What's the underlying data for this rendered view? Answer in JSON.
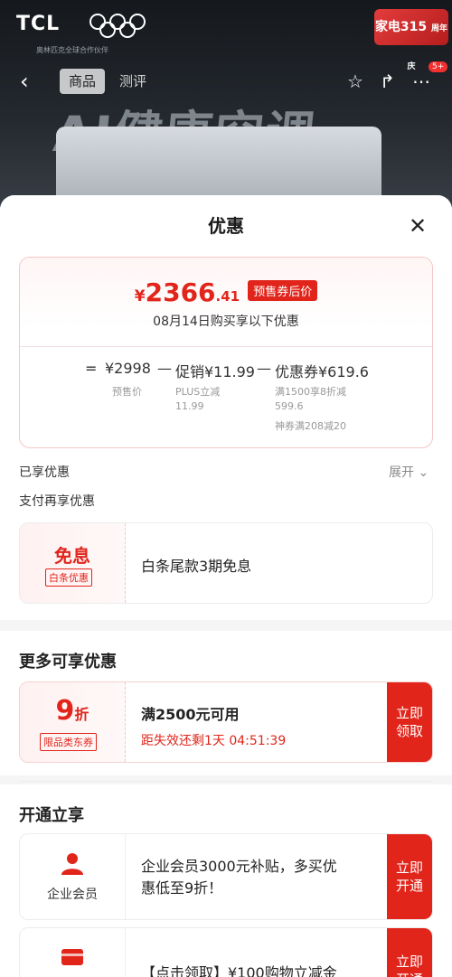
{
  "header": {
    "brand": "TCL",
    "brand_sub": "奥林匹克全球合作伙伴",
    "promo_line1": "家电315",
    "promo_line2": "周年庆",
    "tabs": [
      "商品",
      "测评"
    ],
    "cart_badge": "5+",
    "hero_title": "AI健康空调"
  },
  "sheet": {
    "title": "优惠",
    "price": {
      "yen": "¥",
      "int": "2366",
      "dec": ".41",
      "tag": "预售券后价",
      "date_line": "08月14日购买享以下优惠"
    },
    "formula": {
      "eq": "=",
      "base": "¥2998",
      "minus1": "—",
      "promo": "促销¥11.99",
      "minus2": "—",
      "coupon": "优惠券¥619.6",
      "base_label": "预售价",
      "promo_label1": "PLUS立减",
      "promo_label2": "11.99",
      "coupon_label1": "满1500享8折减",
      "coupon_label2": "599.6",
      "coupon_label3": "神券满208减20"
    },
    "enjoyed": "已享优惠",
    "expand": "展开",
    "pay_title": "支付再享优惠",
    "pay_card": {
      "title": "免息",
      "tag": "白条优惠",
      "text": "白条尾款3期免息"
    },
    "more_title": "更多可享优惠",
    "coupon": {
      "num": "9",
      "unit": "折",
      "tag": "限品类东券",
      "text": "满2500元可用",
      "countdown": "距失效还剩1天 04:51:39",
      "button_line1": "立即",
      "button_line2": "领取"
    },
    "open_title": "开通立享",
    "member": {
      "label": "企业会员",
      "text_line1": "企业会员3000元补贴，多买优",
      "text_line2": "惠低至9折！",
      "button_line1": "立即",
      "button_line2": "开通"
    },
    "card2": {
      "text": "【点击领取】¥100购物立减金",
      "button_line1": "立即",
      "button_line2": "开通"
    }
  },
  "colors": {
    "accent": "#e1251b"
  }
}
